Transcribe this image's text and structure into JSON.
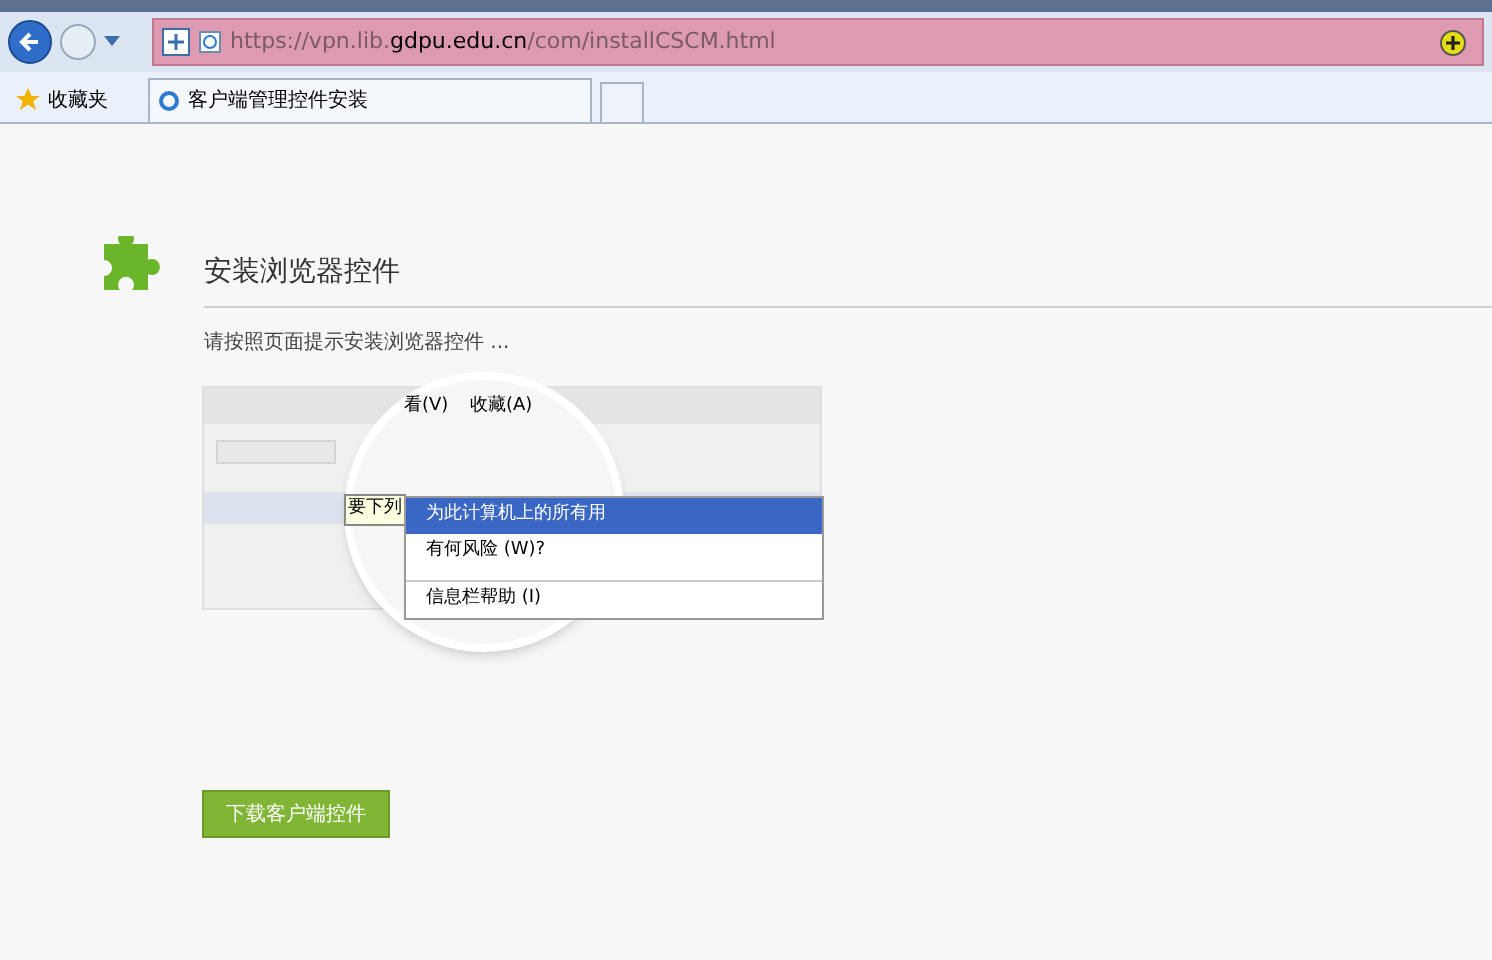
{
  "address_bar": {
    "url_prefix": "https://vpn.lib.",
    "url_domain": "gdpu.edu.cn",
    "url_path": "/com/installCSCM.html"
  },
  "favorites_bar": {
    "favorites": "收藏夹",
    "tabs": [
      {
        "label": "客户端管理控件安装",
        "selected": true
      }
    ]
  },
  "page": {
    "title": "安装浏览器控件",
    "instruction": "请按照页面提示安装浏览器控件 ...",
    "illustration": {
      "menu_title": "收藏(A)",
      "view_menu": "看(V)",
      "bar_text": "要下列",
      "menu_items": [
        {
          "label": "为此计算机上的所有用",
          "highlighted": true
        },
        {
          "label": "有何风险 (W)?",
          "highlighted": false
        },
        {
          "label": "信息栏帮助 (I)",
          "highlighted": false
        }
      ]
    },
    "download_button": "下载客户端控件"
  }
}
